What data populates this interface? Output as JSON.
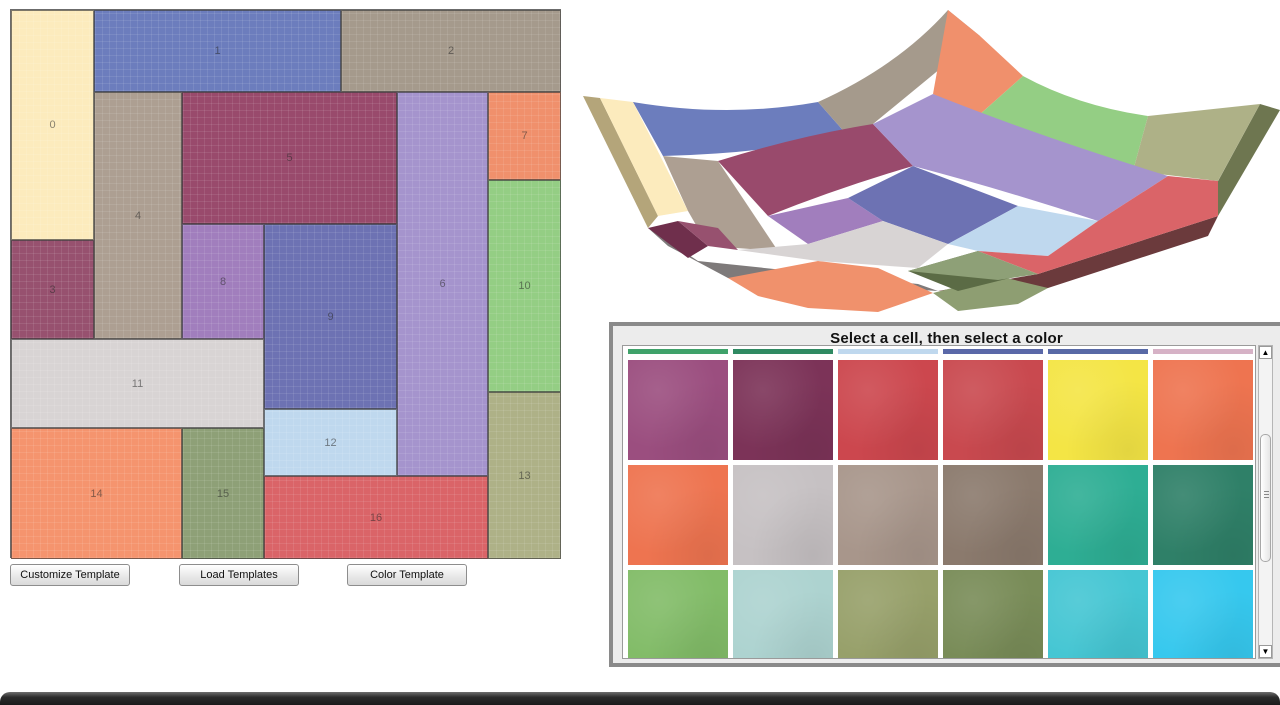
{
  "template": {
    "cells": [
      {
        "label": "0",
        "color": "#fcebbd"
      },
      {
        "label": "1",
        "color": "#6c7dbd"
      },
      {
        "label": "2",
        "color": "#a59a8c"
      },
      {
        "label": "3",
        "color": "#97516f"
      },
      {
        "label": "4",
        "color": "#ad9f92"
      },
      {
        "label": "5",
        "color": "#994a6c"
      },
      {
        "label": "6",
        "color": "#a594cd"
      },
      {
        "label": "7",
        "color": "#f0906c"
      },
      {
        "label": "8",
        "color": "#a17ebd"
      },
      {
        "label": "9",
        "color": "#6d72b3"
      },
      {
        "label": "10",
        "color": "#94ce84"
      },
      {
        "label": "11",
        "color": "#d8d4d4"
      },
      {
        "label": "12",
        "color": "#bfd8ee"
      },
      {
        "label": "13",
        "color": "#aeb187"
      },
      {
        "label": "14",
        "color": "#f5946e"
      },
      {
        "label": "15",
        "color": "#8ea077"
      },
      {
        "label": "16",
        "color": "#da6468"
      }
    ]
  },
  "buttons": {
    "customize": "Customize Template",
    "load": "Load Templates",
    "color": "Color Template"
  },
  "palette": {
    "title": "Select a cell, then select a color",
    "strip_colors": [
      "#3fa26a",
      "#2f8a62",
      "#bfd8ee",
      "#5a68a8",
      "#5869a6",
      "#d6b2c6"
    ],
    "swatches": [
      "#9b4e7f",
      "#7c3358",
      "#cc474e",
      "#c9494f",
      "#f4e545",
      "#ee7450",
      "#ee7450",
      "#c6c1c3",
      "#a8968b",
      "#8b7a6d",
      "#2eae94",
      "#2f8068",
      "#82bc68",
      "#add3d0",
      "#97a06a",
      "#798c58",
      "#45c6d3",
      "#36c8ee"
    ],
    "scroll_up": "▲",
    "scroll_down": "▼"
  }
}
